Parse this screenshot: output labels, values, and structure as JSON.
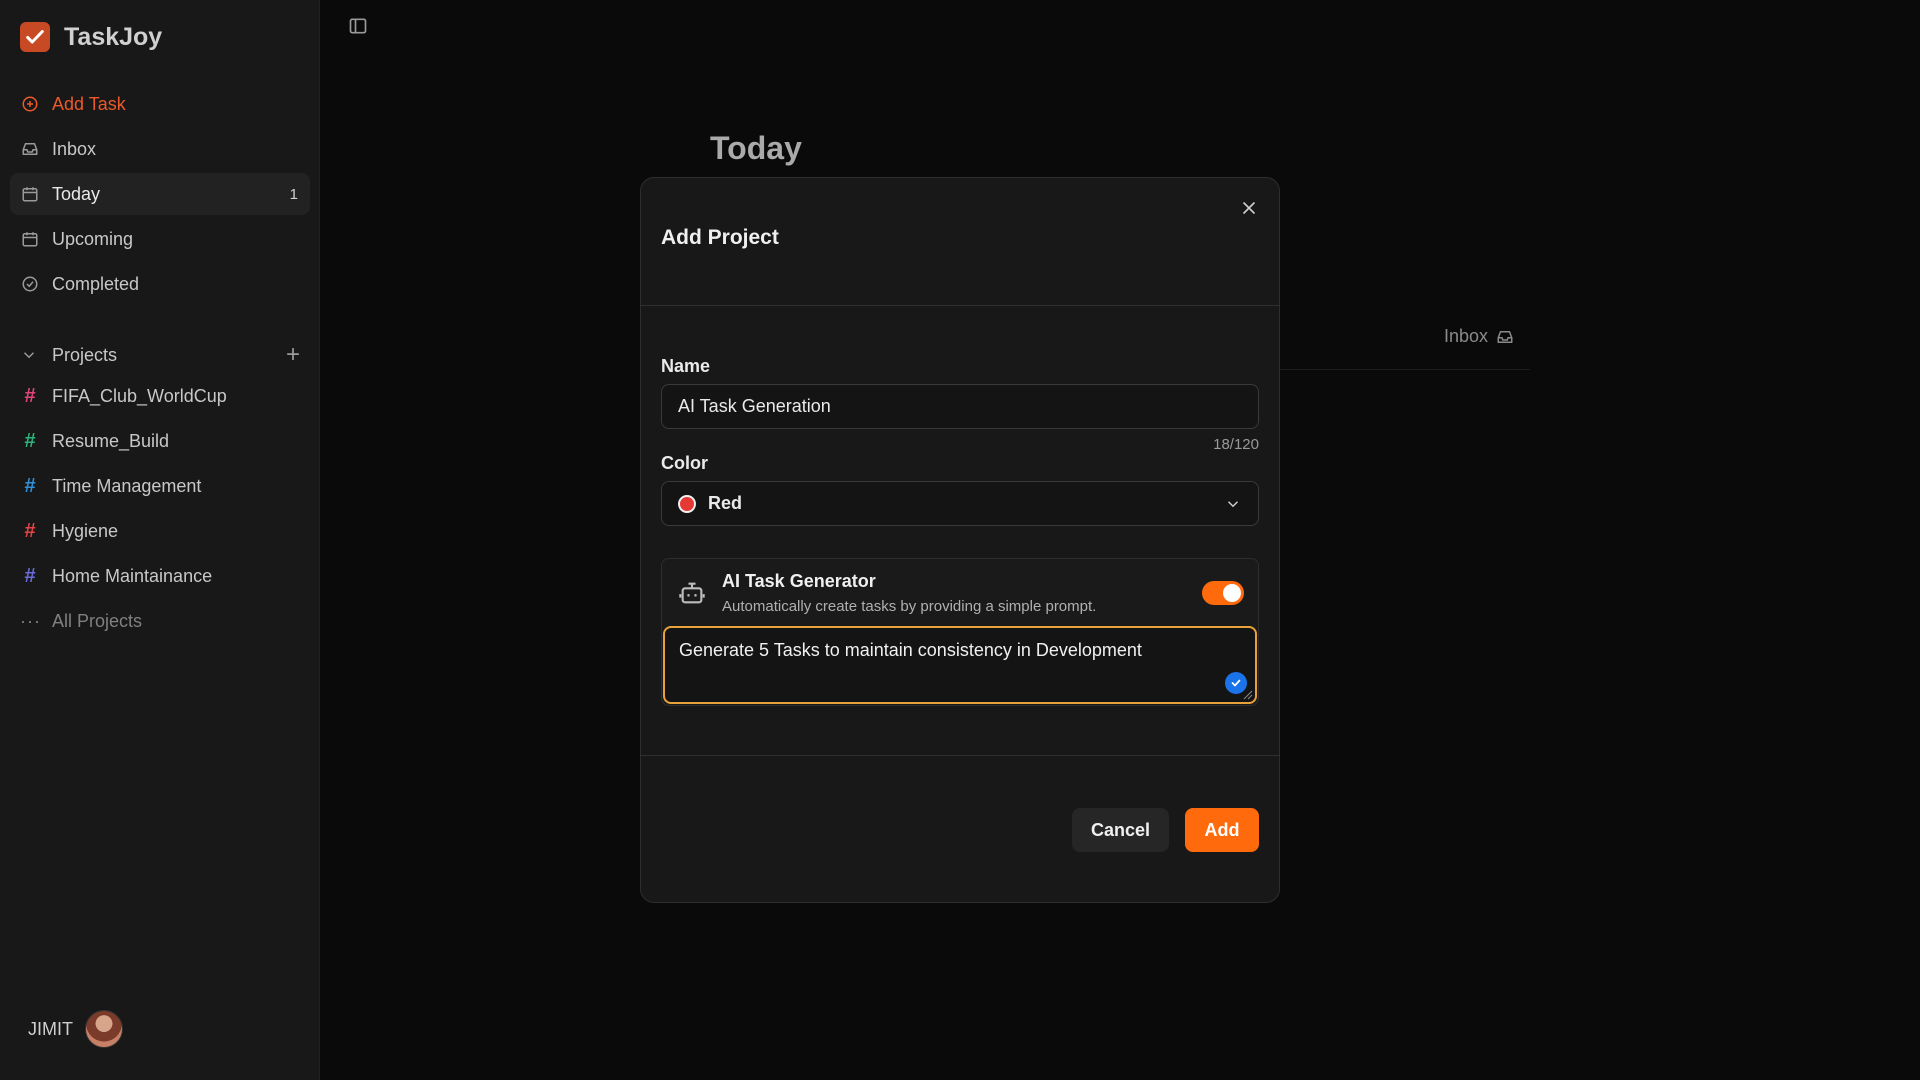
{
  "brand": {
    "name": "TaskJoy",
    "accent": "#c74a25"
  },
  "nav": {
    "add_task": "Add Task",
    "inbox": "Inbox",
    "today": "Today",
    "today_count": "1",
    "upcoming": "Upcoming",
    "completed": "Completed"
  },
  "projects": {
    "heading": "Projects",
    "items": [
      {
        "label": "FIFA_Club_WorldCup",
        "color": "#e0457b"
      },
      {
        "label": "Resume_Build",
        "color": "#2bb37a"
      },
      {
        "label": "Time Management",
        "color": "#2f8fd8"
      },
      {
        "label": "Hygiene",
        "color": "#e04545"
      },
      {
        "label": "Home Maintainance",
        "color": "#6b6bd8"
      }
    ],
    "all_projects": "All Projects"
  },
  "user": {
    "name": "JIMIT"
  },
  "main": {
    "title": "Today",
    "inbox_link": "Inbox"
  },
  "modal": {
    "title": "Add Project",
    "name_label": "Name",
    "name_value": "AI Task Generation",
    "name_counter": "18/120",
    "color_label": "Color",
    "color_value": "Red",
    "color_hex": "#e53935",
    "ai": {
      "title": "AI Task Generator",
      "subtitle": "Automatically create tasks by providing a simple prompt.",
      "enabled": true,
      "prompt": "Generate 5 Tasks to maintain consistency in Development"
    },
    "cancel_label": "Cancel",
    "add_label": "Add",
    "primary_color": "#ff6a0d"
  }
}
